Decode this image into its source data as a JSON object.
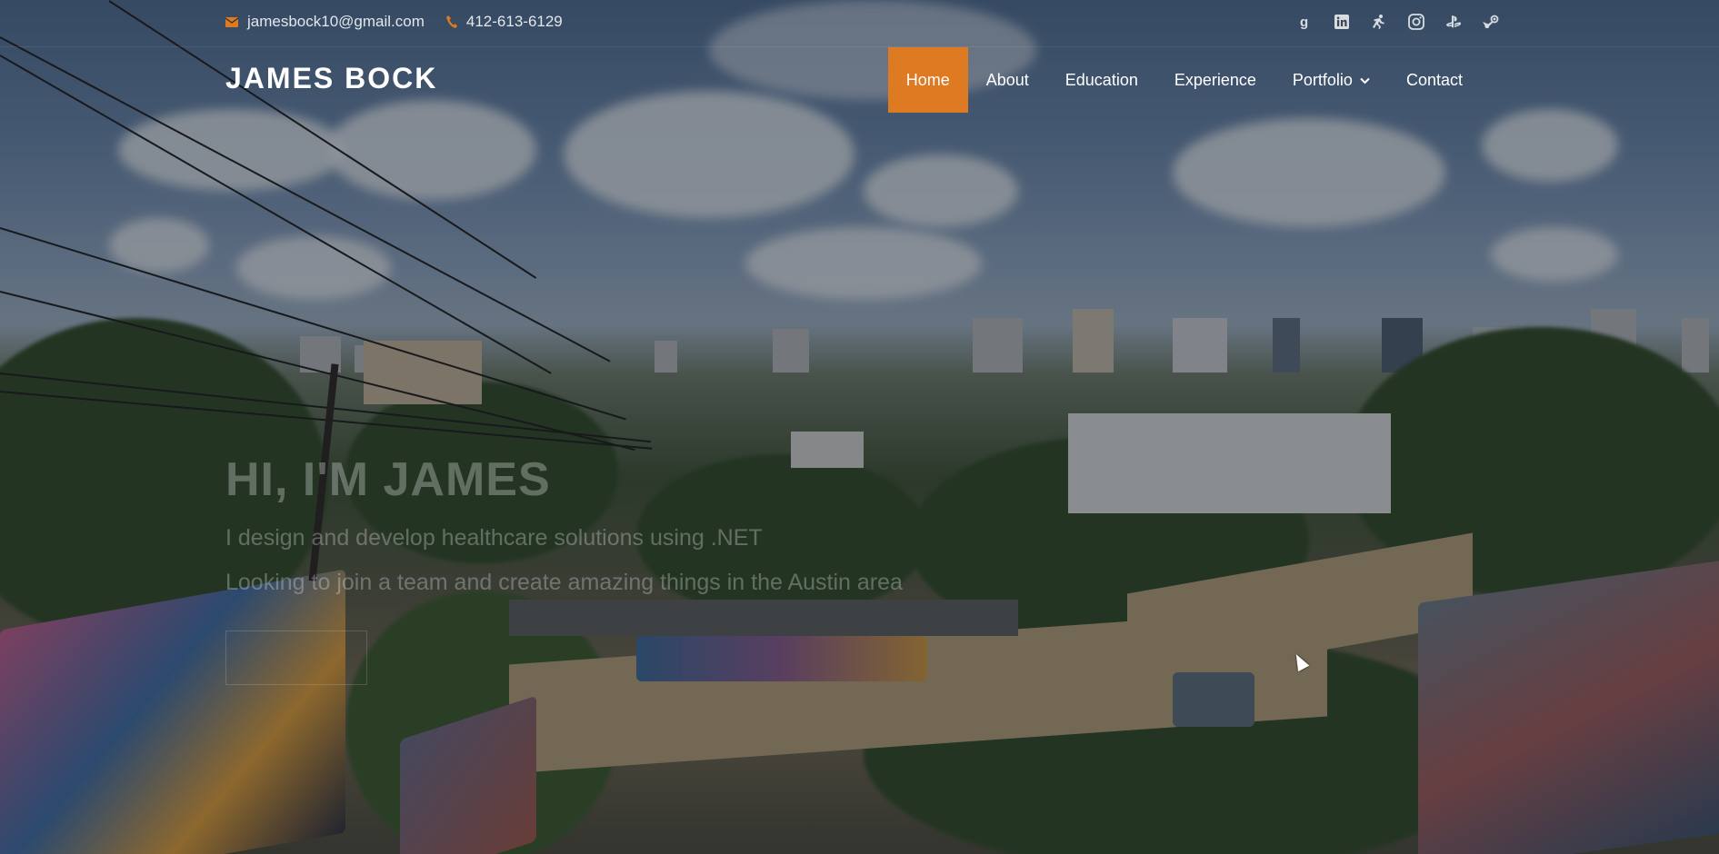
{
  "topbar": {
    "email": "jamesbock10@gmail.com",
    "phone": "412-613-6129",
    "email_icon": "envelope-icon",
    "phone_icon": "phone-icon",
    "social": [
      {
        "name": "goodreads",
        "icon": "goodreads-icon"
      },
      {
        "name": "linkedin",
        "icon": "linkedin-icon"
      },
      {
        "name": "strava",
        "icon": "strava-icon"
      },
      {
        "name": "instagram",
        "icon": "instagram-icon"
      },
      {
        "name": "playstation",
        "icon": "playstation-icon"
      },
      {
        "name": "steam",
        "icon": "steam-icon"
      }
    ]
  },
  "header": {
    "logo": "JAMES BOCK",
    "nav": [
      {
        "label": "Home",
        "active": true
      },
      {
        "label": "About",
        "active": false
      },
      {
        "label": "Education",
        "active": false
      },
      {
        "label": "Experience",
        "active": false
      },
      {
        "label": "Portfolio",
        "active": false,
        "dropdown": true
      },
      {
        "label": "Contact",
        "active": false
      }
    ]
  },
  "hero": {
    "title": "HI, I'M JAMES",
    "line1": "I design and develop healthcare solutions using .NET",
    "line2": "Looking to join a team and create amazing things in the Austin area"
  },
  "colors": {
    "accent": "#dd7a22",
    "text": "#ffffff"
  }
}
